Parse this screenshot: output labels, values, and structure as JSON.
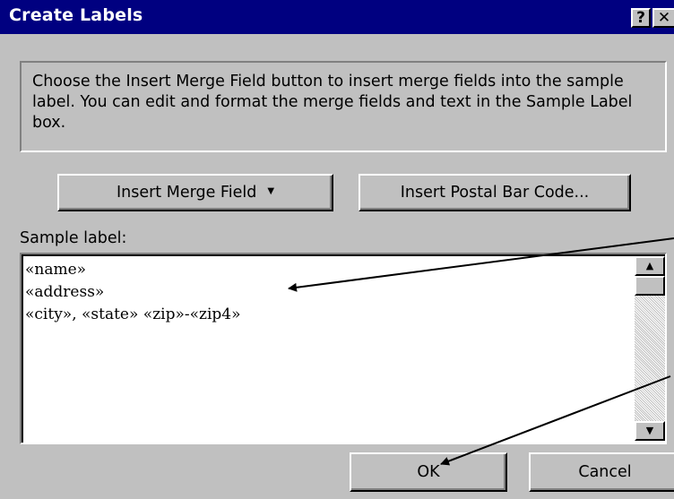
{
  "window": {
    "title": "Create Labels",
    "help_label": "?",
    "close_label": "✕"
  },
  "instructions": {
    "text": "Choose the Insert Merge Field button to insert merge fields into the sample label.  You can edit and format the merge fields and text in the Sample Label box."
  },
  "toolbar": {
    "insert_merge_field_label": "Insert Merge Field",
    "insert_merge_field_caret": "▼",
    "insert_postal_bar_code_label": "Insert Postal Bar Code..."
  },
  "sample_label": {
    "caption": "Sample label:",
    "lines": [
      "«name»",
      "«address»",
      "«city», «state» «zip»-«zip4»"
    ]
  },
  "scrollbar": {
    "up_icon": "▲",
    "down_icon": "▼"
  },
  "footer": {
    "ok_label": "OK",
    "cancel_label": "Cancel"
  }
}
